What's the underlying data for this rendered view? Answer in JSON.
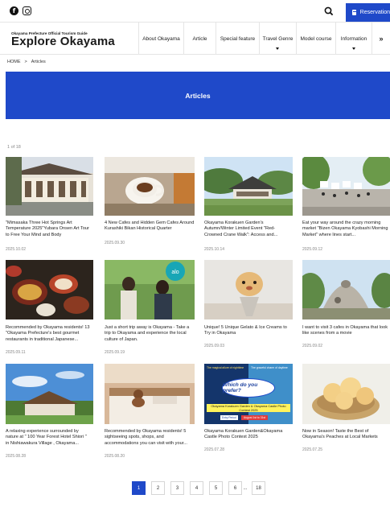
{
  "topbar": {
    "facebook_icon": "facebook-icon",
    "instagram_icon": "instagram-icon",
    "search_icon": "search-icon",
    "reservation_label": "Reservation",
    "accent_color": "#1f49c9"
  },
  "header": {
    "logo_small": "Okayama Prefecture Official Tourism Guide",
    "logo_big": "Explore Okayama",
    "nav": [
      {
        "label": "About Okayama"
      },
      {
        "label": "Article"
      },
      {
        "label": "Special feature"
      },
      {
        "label": "Travel Genre"
      },
      {
        "label": "Model course"
      },
      {
        "label": "Information"
      }
    ],
    "more_label": "»"
  },
  "breadcrumb": {
    "home": "HOME",
    "separator": ">",
    "current": "Articles"
  },
  "banner": {
    "title": "Articles"
  },
  "counter": "1 of 18",
  "articles": [
    {
      "title": "\"Mimasaka Three Hot Springs Art Temperature 2025\"Yubara Onsen Art Tour to Free Your Mind and Body",
      "date": "2025.10.02"
    },
    {
      "title": "4 New Cafes and Hidden Gem Cafes Around Kurashiki Bikan Historical Quarter",
      "date": "2025.09.30"
    },
    {
      "title": "Okayama Korakuen Garden's Autumn/Winter Limited Event \"Red-Crowned Crane Walk\": Access and...",
      "date": "2025.10.14"
    },
    {
      "title": "Eat your way around the crazy morning market \"Bizen Okayama Kyobashi Morning Market\" where lines start...",
      "date": "2025.09.12"
    },
    {
      "title": "Recommended by Okayama residents! 13 \"Okayama Prefecture's best gourmet restaurants in traditional Japanese...",
      "date": "2025.09.11"
    },
    {
      "title": "Just a short trip away is Okayama - Take a trip to Okayama and experience the local culture of Japan.",
      "date": "2025.09.19"
    },
    {
      "title": "Unique! 5 Unique Gelato & Ice Creams to Try in Okayama",
      "date": "2025.09.03"
    },
    {
      "title": "I want to visit 3 cafes in Okayama that look like scenes from a movie",
      "date": "2025.09.02"
    },
    {
      "title": "A relaxing experience surrounded by nature at \" 100 Year Forest Hotel Shiori \" in Nishiawakura Village , Okayama...",
      "date": "2025.08.28"
    },
    {
      "title": "Recommended by Okayama residents! 5 sightseeing spots, shops, and accommodations you can visit with your...",
      "date": "2025.08.20"
    },
    {
      "title": "Okayama Korakuen Garden&Okayama Castle Photo Contest 2025",
      "date": "2025.07.28"
    },
    {
      "title": "Now in Season! Taste the Best of Okayama's Peaches at Local Markets",
      "date": "2025.07.25"
    }
  ],
  "poster": {
    "tag_left": "The magical allure of nighttime",
    "tag_right": "The graceful charm of daytime",
    "headline": "Which do you prefer?",
    "subtitle": "Okayama Korakuen Garden & Okayama Castle Photo Contest 2025",
    "period_label": "Entry Period",
    "period_value": "August 1st to 31st"
  },
  "pagination": [
    "1",
    "2",
    "3",
    "4",
    "5",
    "6",
    "...",
    "18"
  ]
}
